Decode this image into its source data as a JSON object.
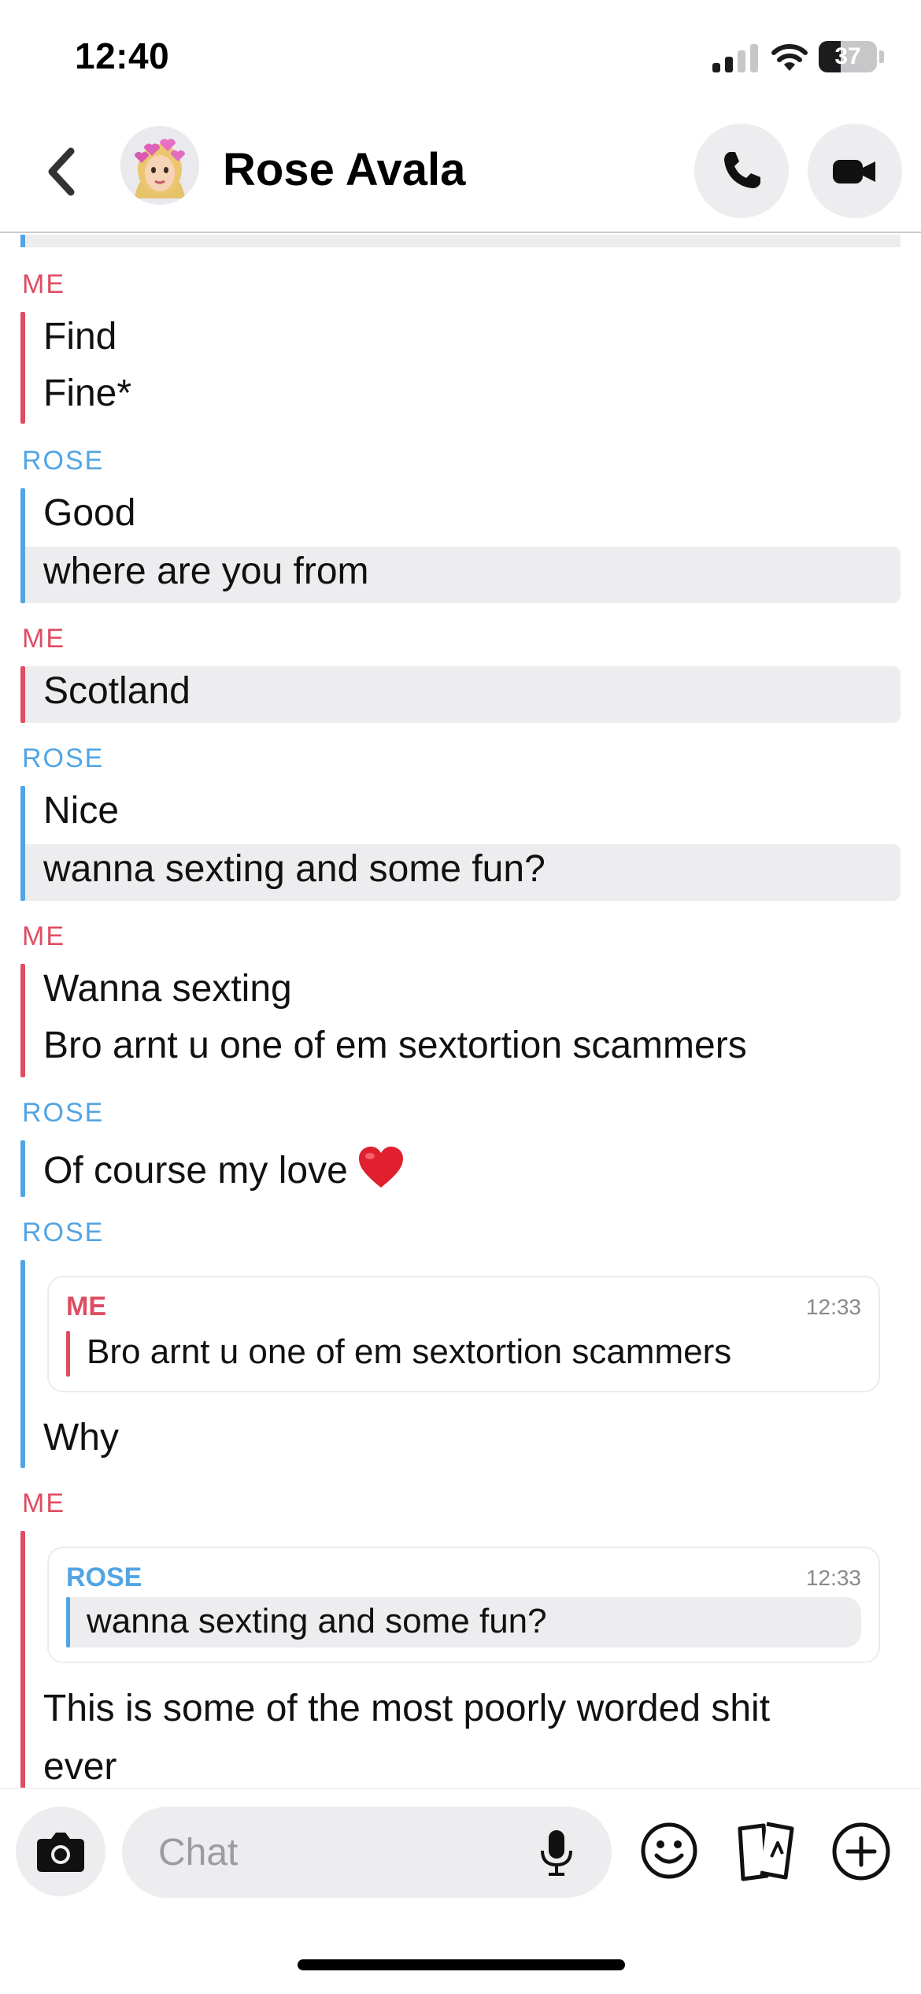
{
  "status_bar": {
    "time": "12:40",
    "battery_level": "37"
  },
  "header": {
    "contact_name": "Rose Avala",
    "back_icon": "chevron-left-icon",
    "call_icon": "phone-icon",
    "video_icon": "video-camera-icon"
  },
  "colors": {
    "me": "#de4d62",
    "rose": "#52a5e4",
    "bubble_highlight": "#ededf0"
  },
  "messages": [
    {
      "sender": "ME",
      "lines": [
        "Find",
        "Fine*"
      ]
    },
    {
      "sender": "ROSE",
      "lines": [
        "Good",
        "where are you from"
      ]
    },
    {
      "sender": "ME",
      "lines": [
        "Scotland"
      ]
    },
    {
      "sender": "ROSE",
      "lines": [
        "Nice",
        "wanna sexting and some fun?"
      ]
    },
    {
      "sender": "ME",
      "lines": [
        "Wanna sexting",
        "Bro arnt u one of em sextortion scammers"
      ]
    },
    {
      "sender": "ROSE",
      "lines": [
        "Of course my love"
      ],
      "emoji": "red-heart"
    },
    {
      "sender": "ROSE",
      "quote": {
        "sender": "ME",
        "time": "12:33",
        "text": "Bro arnt u one of em sextortion scammers"
      },
      "lines": [
        "Why"
      ]
    },
    {
      "sender": "ME",
      "quote": {
        "sender": "ROSE",
        "time": "12:33",
        "text": "wanna sexting and some fun?"
      },
      "lines": [
        "This is some of the most poorly worded shit",
        "ever"
      ]
    }
  ],
  "composer": {
    "placeholder": "Chat",
    "camera_icon": "camera-icon",
    "mic_icon": "microphone-icon",
    "emoji_icon": "smiley-icon",
    "sticker_icon": "stickers-icon",
    "plus_icon": "plus-circle-icon"
  }
}
